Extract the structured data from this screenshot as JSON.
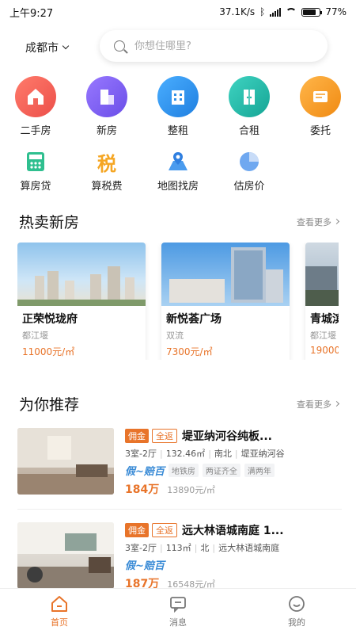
{
  "status": {
    "time": "上午9:27",
    "speed": "37.1K/s",
    "battery": "77%"
  },
  "topbar": {
    "city": "成都市",
    "search_placeholder": "你想住哪里?"
  },
  "categories": [
    {
      "label": "二手房",
      "color": "#f2645a"
    },
    {
      "label": "新房",
      "color": "#7b5cf0"
    },
    {
      "label": "整租",
      "color": "#2f8fe6"
    },
    {
      "label": "合租",
      "color": "#23b8a8"
    },
    {
      "label": "委托",
      "color": "#f59b23"
    }
  ],
  "tools": [
    {
      "label": "算房贷",
      "icon": "calculator-icon"
    },
    {
      "label": "算税费",
      "icon": "tax-icon",
      "glyph": "税"
    },
    {
      "label": "地图找房",
      "icon": "map-pin-icon"
    },
    {
      "label": "估房价",
      "icon": "pie-chart-icon"
    }
  ],
  "hot": {
    "title": "热卖新房",
    "more": "查看更多",
    "items": [
      {
        "name": "正荣悦珑府",
        "district": "都江堰",
        "price": "11000元/㎡"
      },
      {
        "name": "新悦荟广场",
        "district": "双流",
        "price": "7300元/㎡"
      },
      {
        "name": "青城滨",
        "district": "都江堰",
        "price": "19000"
      }
    ]
  },
  "recommend": {
    "title": "为你推荐",
    "more": "查看更多",
    "items": [
      {
        "tag1": "佣金",
        "tag2": "全返",
        "name": "堤亚纳河谷纯板...",
        "layout": "3室-2厅",
        "area": "132.46㎡",
        "orient": "南北",
        "community": "堤亚纳河谷",
        "promo": "假~赔百",
        "tags": [
          "地铁房",
          "两证齐全",
          "满两年"
        ],
        "price": "184万",
        "unit_price": "13890元/㎡"
      },
      {
        "tag1": "佣金",
        "tag2": "全返",
        "name": "远大林语城南庭 1...",
        "layout": "3室-2厅",
        "area": "113㎡",
        "orient": "北",
        "community": "远大林语城南庭",
        "promo": "假~赔百",
        "tags": [],
        "price": "187万",
        "unit_price": "16548元/㎡"
      }
    ]
  },
  "tabs": [
    {
      "label": "首页",
      "active": true
    },
    {
      "label": "消息",
      "active": false
    },
    {
      "label": "我的",
      "active": false
    }
  ]
}
